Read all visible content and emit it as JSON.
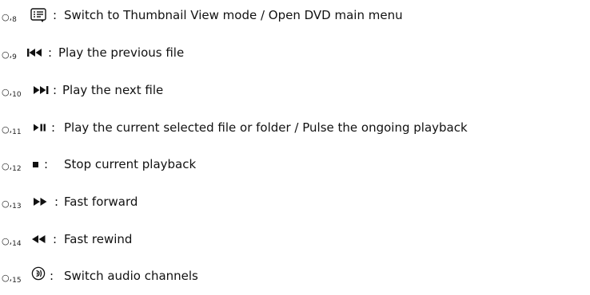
{
  "items": [
    {
      "circle": "○",
      "number": "8",
      "icon": "thumbnail-list-icon",
      "colon": ":",
      "text": "Switch to Thumbnail View mode / Open DVD main menu"
    },
    {
      "circle": "○",
      "number": "9",
      "icon": "previous-track-icon",
      "colon": ":",
      "text": "Play the previous file"
    },
    {
      "circle": "○",
      "number": "10",
      "icon": "next-track-icon",
      "colon": ":",
      "text": "Play the next file"
    },
    {
      "circle": "○",
      "number": "11",
      "icon": "play-pause-icon",
      "colon": ":",
      "text": "Play the current selected file or folder / Pulse the ongoing playback"
    },
    {
      "circle": "○",
      "number": "12",
      "icon": "stop-icon",
      "colon": ":",
      "text": "Stop current playback"
    },
    {
      "circle": "○",
      "number": "13",
      "icon": "fast-forward-icon",
      "colon": ":",
      "text": "Fast forward"
    },
    {
      "circle": "○",
      "number": "14",
      "icon": "fast-rewind-icon",
      "colon": ":",
      "text": "Fast rewind"
    },
    {
      "circle": "○",
      "number": "15",
      "icon": "audio-channel-icon",
      "colon": ":",
      "text": "Switch audio channels"
    }
  ]
}
